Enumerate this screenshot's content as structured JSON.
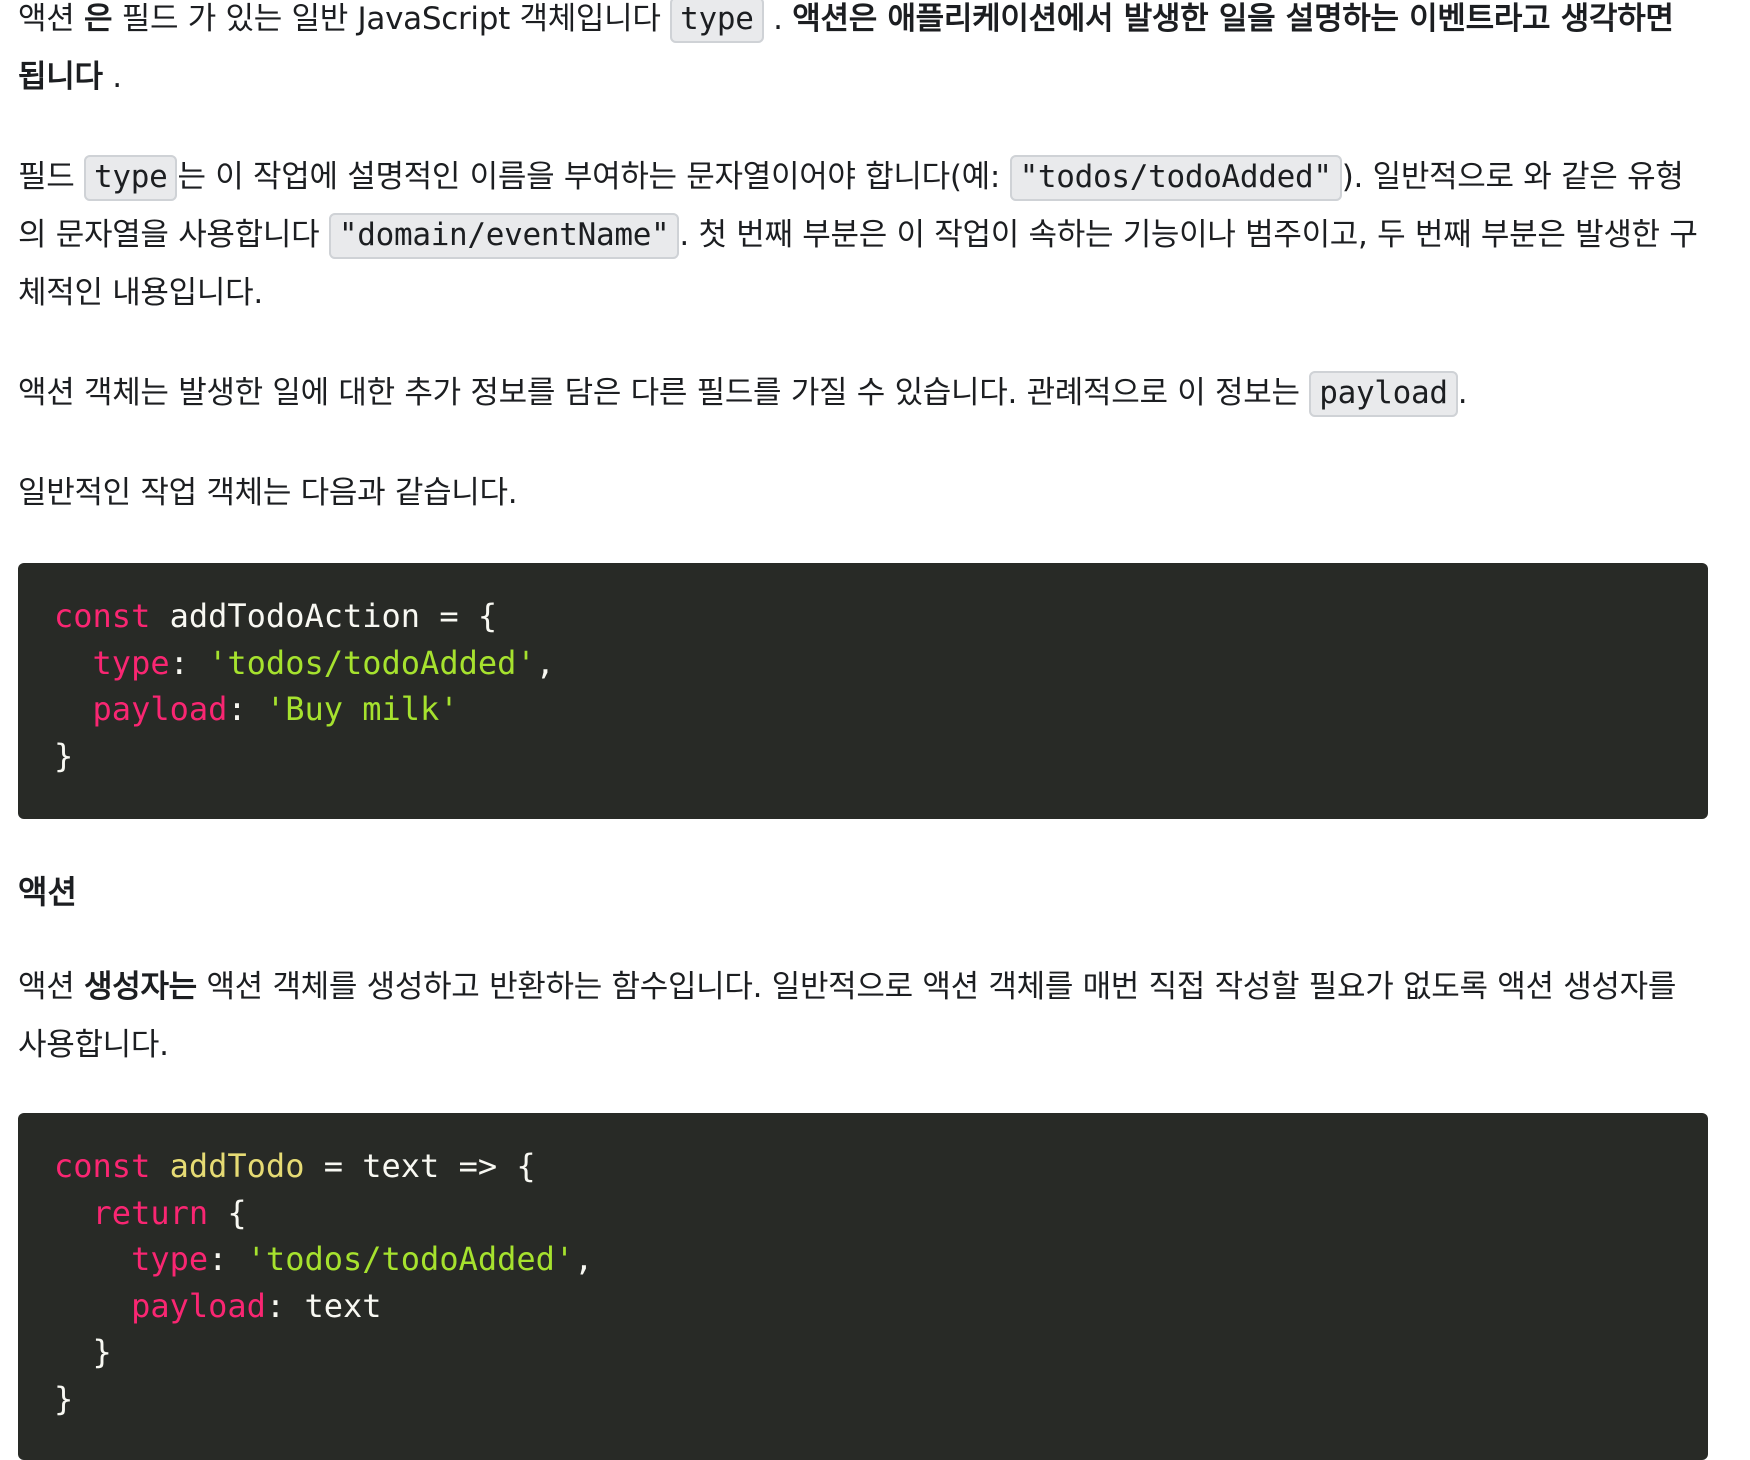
{
  "paragraph1": {
    "t1": "액션 ",
    "b1": "은",
    "t2": " 필드 가 있는 일반 JavaScript 객체입니다 ",
    "code1": "type",
    "t3": " . ",
    "b2": "액션은 애플리케이션에서 발생한 일을 설명하는 이벤트라고 생각하면 됩니다",
    "t4": " ."
  },
  "paragraph2": {
    "t1": "필드 ",
    "code1": "type",
    "t2": "는 이 작업에 설명적인 이름을 부여하는 문자열이어야 합니다(예: ",
    "code2": "\"todos/todoAdded\"",
    "t3": "). 일반적으로 와 같은 유형의 문자열을 사용합니다 ",
    "code3": "\"domain/eventName\"",
    "t4": ". 첫 번째 부분은 이 작업이 속하는 기능이나 범주이고, 두 번째 부분은 발생한 구체적인 내용입니다."
  },
  "paragraph3": {
    "t1": "액션 객체는 발생한 일에 대한 추가 정보를 담은 다른 필드를 가질 수 있습니다. 관례적으로 이 정보는 ",
    "code1": "payload",
    "t2": "."
  },
  "paragraph4": {
    "t1": "일반적인 작업 객체는 다음과 같습니다."
  },
  "code_block_1": {
    "kw_const": "const",
    "name": " addTodoAction = {",
    "prop_type": "type",
    "colon1": ": ",
    "val_type": "'todos/todoAdded'",
    "comma1": ",",
    "prop_payload": "payload",
    "colon2": ": ",
    "val_payload": "'Buy milk'",
    "close": "}"
  },
  "heading_actions": "액션",
  "paragraph5": {
    "t1": "액션 ",
    "b1": "생성자는",
    "t2": " 액션 객체를 생성하고 반환하는 함수입니다. 일반적으로 액션 객체를 매번 직접 작성할 필요가 없도록 액션 생성자를 사용합니다."
  },
  "code_block_2": {
    "kw_const": "const",
    "fn_name": "addTodo",
    "rest1": " = text => {",
    "kw_return": "return",
    "rest2": " {",
    "prop_type": "type",
    "colon1": ": ",
    "val_type": "'todos/todoAdded'",
    "comma1": ",",
    "prop_payload": "payload",
    "colon2": ": ",
    "val_payload": "text",
    "close_inner": "}",
    "close_outer": "}"
  }
}
